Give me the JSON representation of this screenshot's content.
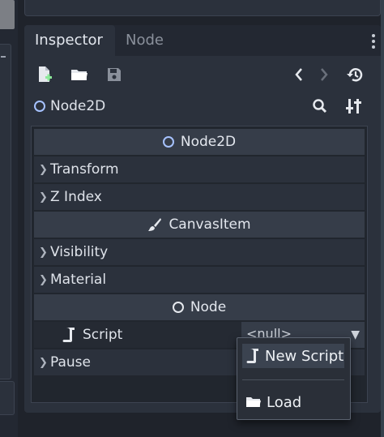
{
  "tabs": [
    {
      "label": "Inspector",
      "active": true
    },
    {
      "label": "Node",
      "active": false
    }
  ],
  "toolbar": {
    "icons": [
      "new-resource-icon",
      "load-icon",
      "save-icon",
      "back-icon",
      "forward-icon",
      "history-icon"
    ]
  },
  "path": {
    "node_name": "Node2D",
    "icons": [
      "node2d-icon",
      "search-icon",
      "object-settings-icon"
    ]
  },
  "sections": {
    "node2d": "Node2D",
    "canvasitem": "CanvasItem",
    "node": "Node"
  },
  "groups": {
    "transform": "Transform",
    "z_index": "Z Index",
    "visibility": "Visibility",
    "material": "Material",
    "pause": "Pause"
  },
  "script_property": {
    "label": "Script",
    "value": "<null>"
  },
  "popup": {
    "items": [
      {
        "label": "New Script",
        "icon": "script-icon"
      },
      {
        "label": "Load",
        "icon": "folder-icon"
      }
    ]
  },
  "colors": {
    "accent_node2d": "#a6c2ff",
    "panel": "#2b313c",
    "section": "#363d49"
  }
}
